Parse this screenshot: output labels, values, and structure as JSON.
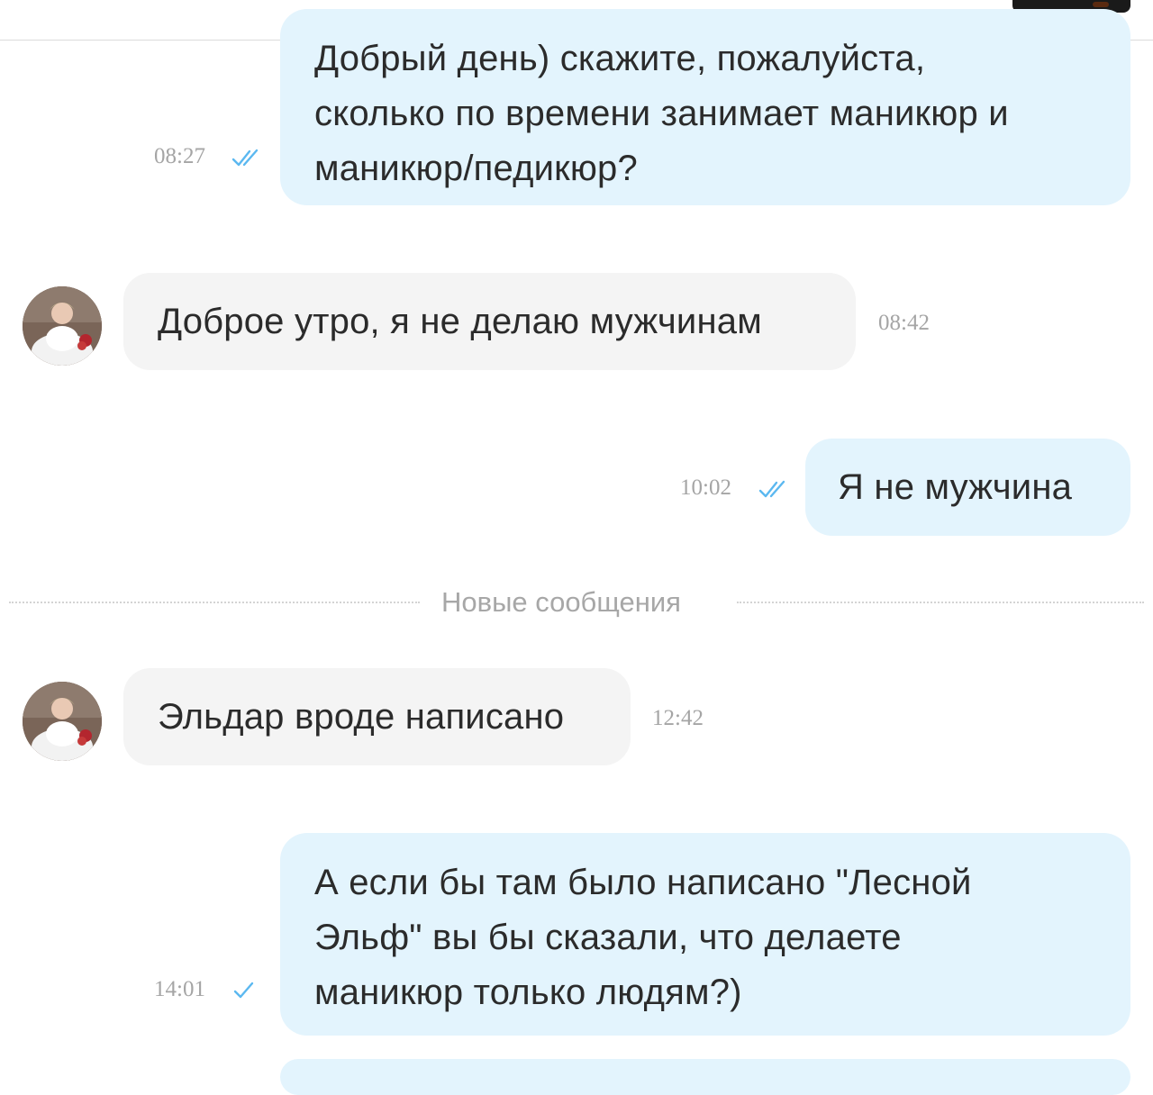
{
  "colors": {
    "outgoing_bubble": "#e3f4fd",
    "incoming_bubble": "#f4f4f4",
    "read_check": "#5bb8f0",
    "timestamp": "#a5a5a5"
  },
  "messages": [
    {
      "direction": "outgoing",
      "lines": [
        "Добрый день) скажите, пожалуйста,",
        "сколько по времени занимает маникюр и",
        "маникюр/педикюр?"
      ],
      "time": "08:27",
      "status_icon": "double-check-icon"
    },
    {
      "direction": "incoming",
      "lines": [
        "Доброе утро, я не делаю мужчинам"
      ],
      "time": "08:42",
      "avatar_icon": "avatar"
    },
    {
      "direction": "outgoing",
      "lines": [
        "Я не мужчина"
      ],
      "time": "10:02",
      "status_icon": "double-check-icon"
    },
    {
      "direction": "incoming",
      "lines": [
        "Эльдар вроде написано"
      ],
      "time": "12:42",
      "avatar_icon": "avatar"
    },
    {
      "direction": "outgoing",
      "lines": [
        "А если бы там было написано \"Лесной",
        "Эльф\" вы бы сказали, что делаете",
        "маникюр только людям?)"
      ],
      "time": "14:01",
      "status_icon": "single-check-icon"
    }
  ],
  "new_messages_divider": "Новые сообщения"
}
